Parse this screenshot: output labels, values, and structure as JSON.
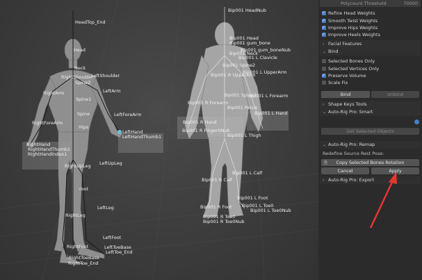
{
  "panel": {
    "header": {
      "label": "Polycount Threshold",
      "value": "70000"
    },
    "checks": [
      {
        "label": "Refine Head Weights",
        "checked": true
      },
      {
        "label": "Smooth Twist Weights",
        "checked": true
      },
      {
        "label": "Improve Hips Weights",
        "checked": true
      },
      {
        "label": "Improve Heels Weights",
        "checked": true
      }
    ],
    "facial_features": "Facial Features",
    "bind_section": "Bind",
    "checks2": [
      {
        "label": "Selected Bones Only",
        "checked": false
      },
      {
        "label": "Selected Vertices Only",
        "checked": false
      },
      {
        "label": "Preserve Volume",
        "checked": true
      },
      {
        "label": "Scale Fix",
        "checked": false
      }
    ],
    "bind_button": "Bind",
    "unbind_button": "Unbind",
    "shape_keys_tools": "Shape Keys Tools",
    "smart_section": "Auto-Rig Pro: Smart",
    "get_selected_objects": "Get Selected Objects",
    "remap_section": "Auto-Rig Pro: Remap",
    "redefine_label": "Redefine Source Rest Pose:",
    "copy_rotation_button": "Copy Selected Bones Rotation",
    "cancel_button": "Cancel",
    "apply_button": "Apply",
    "export_section": "Auto-Rig Pro: Export"
  },
  "left_labels": [
    "HeadTop_End",
    "Head",
    "Neck",
    "RightShoulder",
    "LeftShoulder",
    "Spine2",
    "RightArm",
    "LeftArm",
    "Spine1",
    "Spine",
    "LeftForeArm",
    "RightForeArm",
    "Hips",
    "LeftHand",
    "LeftHandThumb1",
    "RightHand",
    "RightHandThumb1",
    "RightHandIndex1",
    "LeftUpLeg",
    "RightUpLeg",
    "root",
    "LeftLeg",
    "RightLeg",
    "LeftFoot",
    "RightFoot",
    "LeftToeBase",
    "RightToeBase",
    "LeftToe_End",
    "RightToe_End"
  ],
  "right_labels": [
    "Bip001 HeadNub",
    "Bip001 Head",
    "Bip001 gum_bone",
    "Bip001 Neck",
    "Bip001 gum_boneNub",
    "Bip001 L Clavicle",
    "Bip001 Spine2",
    "Bip001 L UpperArm",
    "Bip001 R UpperArm",
    "Bip001 Spine1",
    "Bip001 L Forearm",
    "Bip001 R Forearm",
    "Bip001 Pelvis",
    "Bip001 L Hand",
    "Bip001 R Hand",
    "Bip001 R Finger0Nub",
    "Bip001 L Thigh",
    "Bip001 L Calf",
    "Bip001 R Calf",
    "Bip001 L Foot",
    "Bip001 R Foot",
    "Bip001 L Toe0",
    "Bip001 R Toe0",
    "Bip001 L Toe0Nub",
    "Bip001 R Toe0Nub"
  ]
}
